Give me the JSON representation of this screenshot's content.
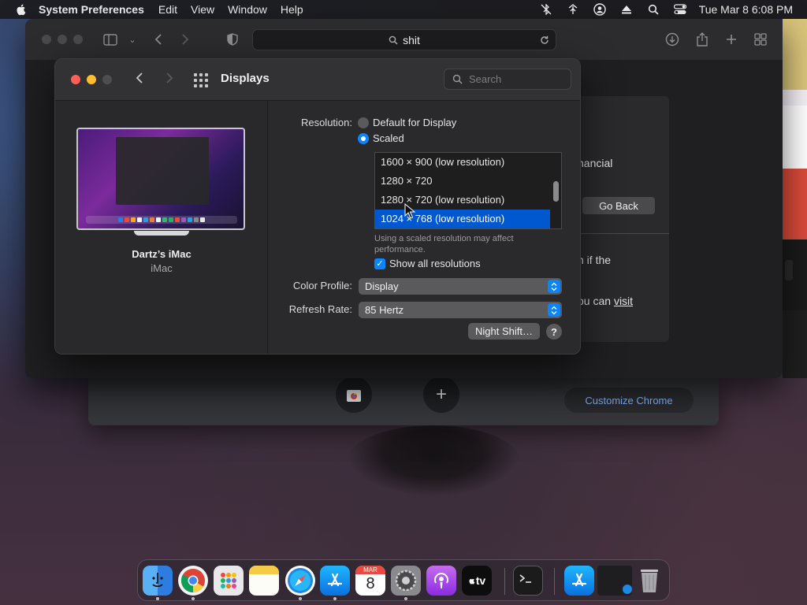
{
  "menubar": {
    "app_name": "System Preferences",
    "menus": [
      "Edit",
      "View",
      "Window",
      "Help"
    ],
    "clock": "Tue Mar 8  6:08 PM"
  },
  "safari": {
    "address": "shit",
    "page_fragments": {
      "financial": "nancial",
      "go_back": "Go Back",
      "line1": "n if the",
      "line2_prefix": "ou can ",
      "line2_link": "visit"
    }
  },
  "chrome": {
    "customize_label": "Customize Chrome",
    "add_symbol": "+"
  },
  "prefs": {
    "title": "Displays",
    "search_placeholder": "Search",
    "device_name": "Dartz’s iMac",
    "device_model": "iMac",
    "resolution_label": "Resolution:",
    "option_default": "Default for Display",
    "option_scaled": "Scaled",
    "resolutions": [
      "1600 × 900 (low resolution)",
      "1280 × 720",
      "1280 × 720 (low resolution)",
      "1024 × 768 (low resolution)"
    ],
    "selected_resolution_index": 3,
    "hint": "Using a scaled resolution may affect performance.",
    "show_all_label": "Show all resolutions",
    "color_profile_label": "Color Profile:",
    "color_profile_value": "Display",
    "refresh_rate_label": "Refresh Rate:",
    "refresh_rate_value": "85 Hertz",
    "night_shift_label": "Night Shift…",
    "help_label": "?"
  },
  "dock": {
    "calendar_month": "MAR",
    "calendar_day": "8",
    "tv_label": "tv"
  },
  "colors": {
    "accent": "#0a84ff",
    "selection": "#0058d0",
    "close": "#ff5f57",
    "minimize": "#febc2e"
  }
}
